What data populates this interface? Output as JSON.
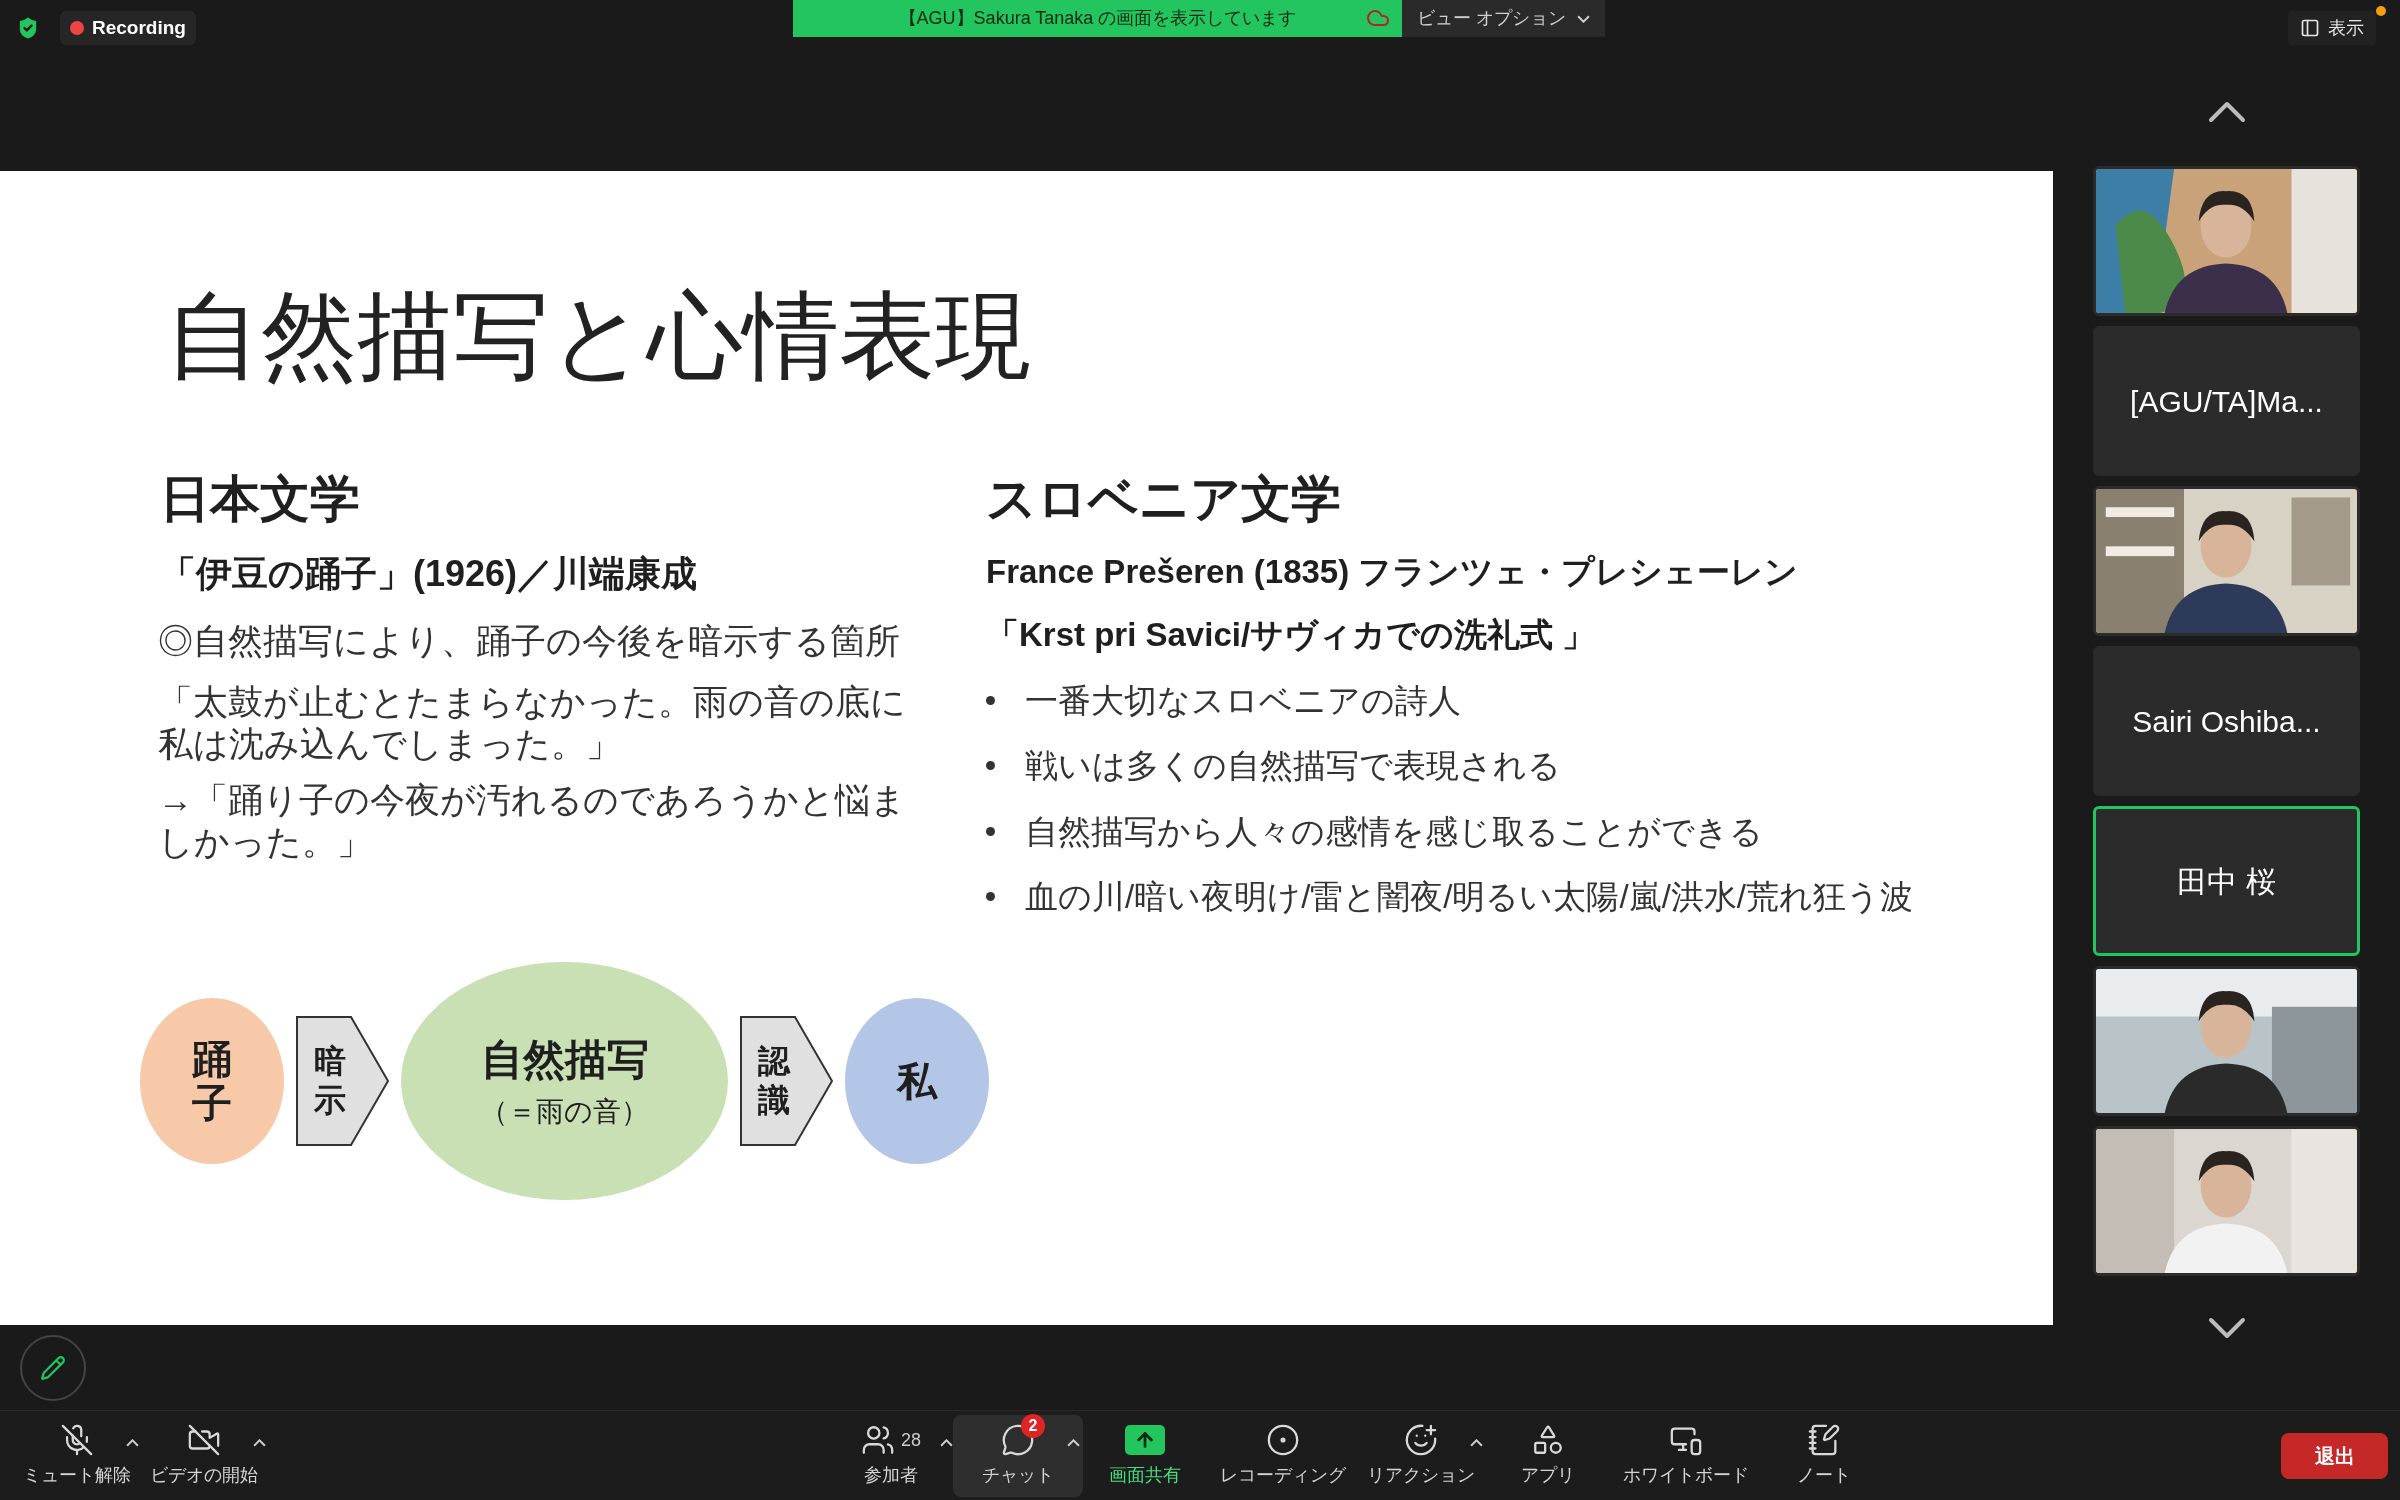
{
  "top_bar": {
    "recording": {
      "label": "Recording"
    },
    "share_banner": {
      "text": "【AGU】Sakura Tanaka の画面を表示しています"
    },
    "view_options": {
      "label": "ビュー オプション"
    },
    "view_button": {
      "label": "表示"
    }
  },
  "slide": {
    "title": "自然描写と心情表現",
    "left": {
      "heading": "日本文学",
      "work": "「伊豆の踊子」(1926)／川端康成",
      "note": "◎自然描写により、踊子の今後を暗示する箇所",
      "quote": [
        "「太鼓が止むとたまらなかった。雨の音の底に",
        "私は沈み込んでしまった。」"
      ],
      "consequence": [
        "→「踊り子の今夜が汚れるのであろうかと悩ま",
        "しかった。」"
      ]
    },
    "diagram": [
      {
        "kind": "ellipse",
        "text": "踊子",
        "color": "#f8c9a9"
      },
      {
        "kind": "arrow",
        "text": "暗示"
      },
      {
        "kind": "big_ellipse",
        "text": "自然描写",
        "sub": "（＝雨の音）",
        "color": "#c8e0b4"
      },
      {
        "kind": "arrow",
        "text": "認識"
      },
      {
        "kind": "ellipse",
        "text": "私",
        "color": "#b4c6e7"
      }
    ],
    "right": {
      "heading": "スロベニア文学",
      "author": "France Prešeren (1835) フランツェ・プレシェーレン",
      "work": "「Krst pri Savici/サヴィカでの洗礼式 」",
      "bullets": [
        "一番大切なスロベニアの詩人",
        "戦いは多くの自然描写で表現される",
        "自然描写から人々の感情を感じ取ることができる",
        "血の川/暗い夜明け/雷と闇夜/明るい太陽/嵐/洪水/荒れ狂う波"
      ]
    }
  },
  "participants": [
    {
      "kind": "video",
      "speaking": false
    },
    {
      "kind": "name",
      "name": "[AGU/TA]Ma...",
      "speaking": false
    },
    {
      "kind": "video",
      "speaking": false
    },
    {
      "kind": "name",
      "name": "Sairi Oshiba...",
      "speaking": false
    },
    {
      "kind": "name",
      "name": "田中 桜",
      "speaking": true
    },
    {
      "kind": "video",
      "speaking": false
    },
    {
      "kind": "video",
      "speaking": false
    }
  ],
  "toolbar": [
    {
      "kind": "mic",
      "label": "ミュート解除",
      "has_menu": true,
      "selected": false
    },
    {
      "kind": "video",
      "label": "ビデオの開始",
      "has_menu": true,
      "selected": false
    },
    {
      "kind": "people",
      "label": "参加者",
      "count": "28",
      "has_menu": true,
      "selected": false
    },
    {
      "kind": "chat",
      "label": "チャット",
      "badge": "2",
      "has_menu": true,
      "selected": true
    },
    {
      "kind": "share",
      "label": "画面共有",
      "has_menu": false,
      "selected": false
    },
    {
      "kind": "record",
      "label": "レコーディング",
      "has_menu": false,
      "selected": false
    },
    {
      "kind": "reaction",
      "label": "リアクション",
      "has_menu": true,
      "selected": false
    },
    {
      "kind": "apps",
      "label": "アプリ",
      "has_menu": false,
      "selected": false
    },
    {
      "kind": "whiteboard",
      "label": "ホワイトボード",
      "has_menu": false,
      "selected": false
    },
    {
      "kind": "notes",
      "label": "ノート",
      "has_menu": false,
      "selected": false
    }
  ],
  "leave_button": {
    "label": "退出"
  }
}
